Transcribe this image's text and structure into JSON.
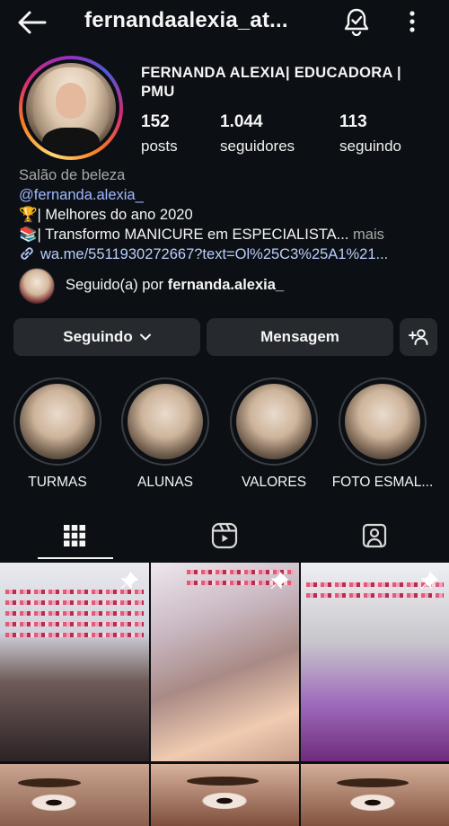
{
  "header": {
    "username": "fernandaalexia_at...",
    "back_icon": "arrow-left-icon",
    "notify_icon": "bell-check-icon",
    "menu_icon": "more-vertical-icon"
  },
  "profile": {
    "display_name": "FERNANDA ALEXIA| EDUCADORA | PMU",
    "stats": [
      {
        "value": "152",
        "label": "posts"
      },
      {
        "value": "1.044",
        "label": "seguidores"
      },
      {
        "value": "113",
        "label": "seguindo"
      }
    ]
  },
  "bio": {
    "category": "Salão de beleza",
    "handle": "@fernanda.alexia_",
    "line1": "🏆| Melhores do ano 2020",
    "line2": "📚| Transformo MANICURE em ESPECIALISTA...",
    "more": " mais",
    "link": "wa.me/5511930272667?text=Ol%25C3%25A1%21..."
  },
  "followed_by": {
    "prefix": "Seguido(a) por ",
    "user": "fernanda.alexia_"
  },
  "actions": {
    "follow_label": "Seguindo",
    "message_label": "Mensagem",
    "add_user_icon": "add-person-icon"
  },
  "highlights": [
    {
      "label": "TURMAS"
    },
    {
      "label": "ALUNAS"
    },
    {
      "label": "VALORES"
    },
    {
      "label": "FOTO ESMAL..."
    }
  ],
  "tabs": [
    {
      "name": "grid",
      "icon": "grid-icon",
      "active": true
    },
    {
      "name": "reels",
      "icon": "reels-icon",
      "active": false
    },
    {
      "name": "tagged",
      "icon": "tagged-person-icon",
      "active": false
    }
  ],
  "colors": {
    "background": "#0c1014",
    "button": "#262a2f",
    "link": "#b9cdfb",
    "muted": "#a8a8a8"
  }
}
